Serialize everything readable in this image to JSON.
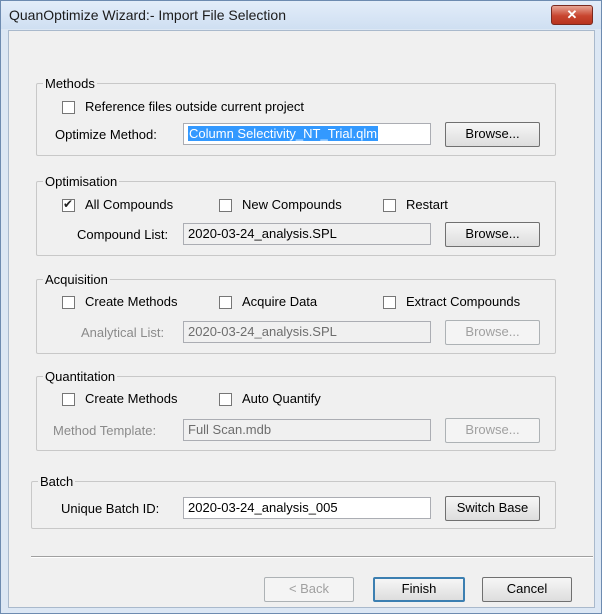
{
  "window": {
    "title": "QuanOptimize Wizard:- Import File Selection",
    "close_icon": "close-icon",
    "close_glyph": "✕"
  },
  "methods": {
    "legend": "Methods",
    "ref_files_label": "Reference files outside current project",
    "ref_files_checked": false,
    "optimize_label": "Optimize Method:",
    "optimize_value": "Column Selectivity_NT_Trial.qlm",
    "browse_label": "Browse..."
  },
  "optimisation": {
    "legend": "Optimisation",
    "all_label": "All Compounds",
    "all_checked": true,
    "new_label": "New Compounds",
    "restart_label": "Restart",
    "list_label": "Compound List:",
    "list_value": "2020-03-24_analysis.SPL",
    "browse_label": "Browse..."
  },
  "acquisition": {
    "legend": "Acquisition",
    "create_label": "Create Methods",
    "acquire_label": "Acquire Data",
    "extract_label": "Extract Compounds",
    "list_label": "Analytical List:",
    "list_value": "2020-03-24_analysis.SPL",
    "browse_label": "Browse..."
  },
  "quantitation": {
    "legend": "Quantitation",
    "create_label": "Create Methods",
    "auto_label": "Auto Quantify",
    "template_label": "Method Template:",
    "template_value": "Full Scan.mdb",
    "browse_label": "Browse..."
  },
  "batch": {
    "legend": "Batch",
    "id_label": "Unique Batch ID:",
    "id_value": "2020-03-24_analysis_005",
    "switch_label": "Switch Base"
  },
  "footer": {
    "back_label": "< Back",
    "finish_label": "Finish",
    "cancel_label": "Cancel"
  },
  "colors": {
    "title_bar": "#cfdff2",
    "close_button": "#c8452f",
    "selection": "#3399ff",
    "dialog_bg": "#f0f0f0"
  }
}
